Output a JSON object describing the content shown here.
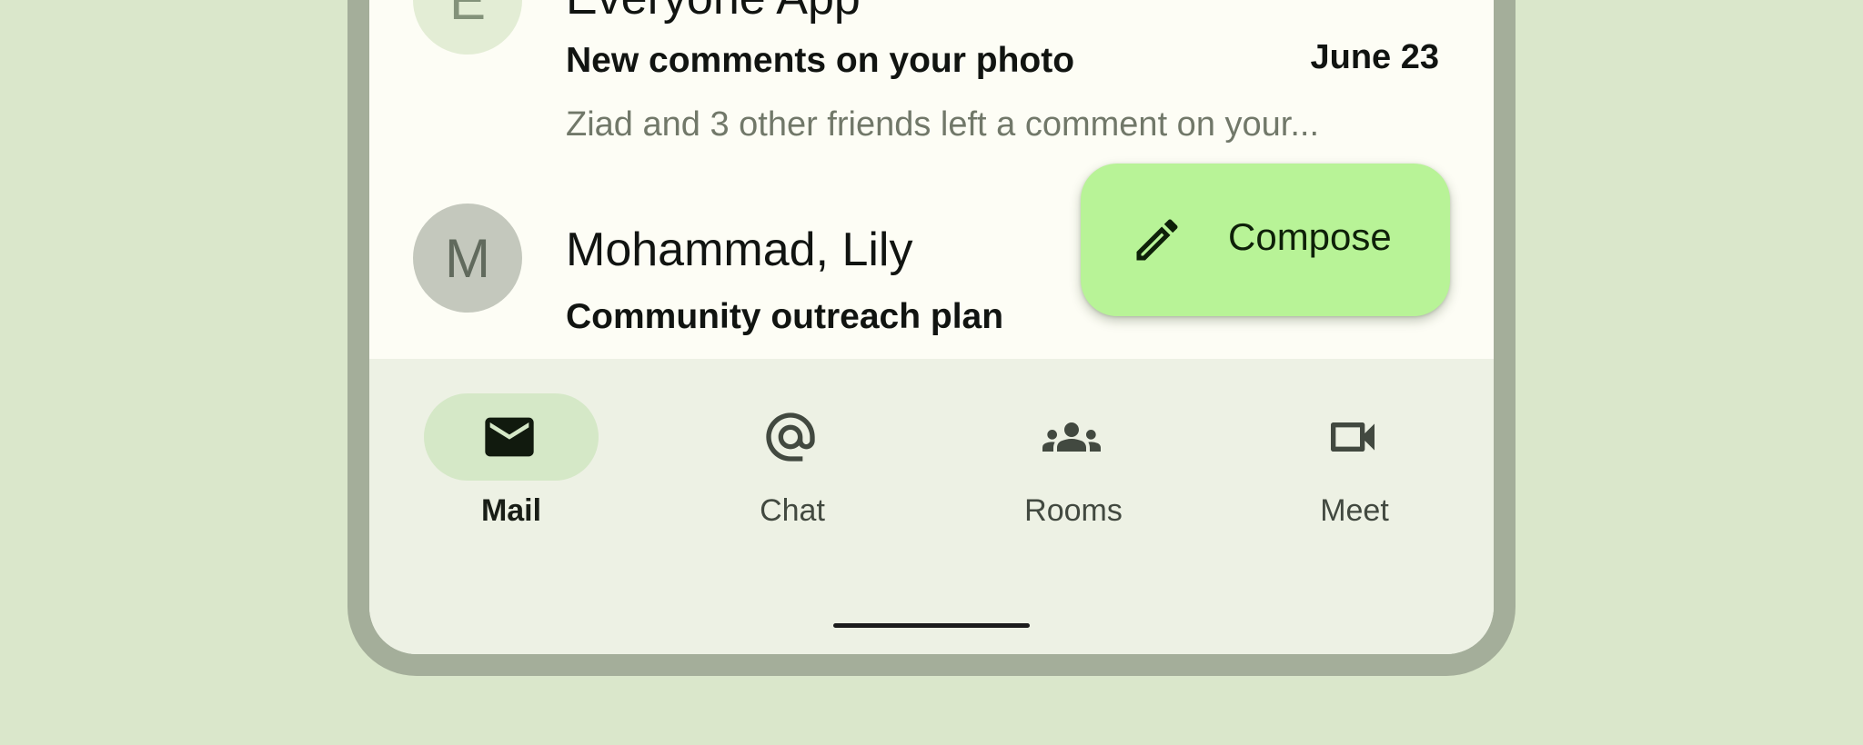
{
  "emails": [
    {
      "avatar_letter": "E",
      "sender": "Everyone App",
      "subject": "New comments on your photo",
      "date": "June 23",
      "preview": "Ziad and 3 other friends left a comment on your..."
    },
    {
      "avatar_letter": "M",
      "sender": "Mohammad, Lily",
      "subject": "Community outreach plan"
    }
  ],
  "fab": {
    "label": "Compose",
    "icon": "pencil-icon"
  },
  "nav": {
    "items": [
      {
        "label": "Mail",
        "icon": "mail-icon",
        "active": true
      },
      {
        "label": "Chat",
        "icon": "at-sign-icon",
        "active": false
      },
      {
        "label": "Rooms",
        "icon": "group-icon",
        "active": false
      },
      {
        "label": "Meet",
        "icon": "video-camera-icon",
        "active": false
      }
    ]
  },
  "colors": {
    "background": "#dae7cb",
    "device_frame": "#a4ae9a",
    "fab": "#b8f397",
    "nav_bar": "#edf1e4",
    "nav_active_pill": "#d5e8c7"
  }
}
